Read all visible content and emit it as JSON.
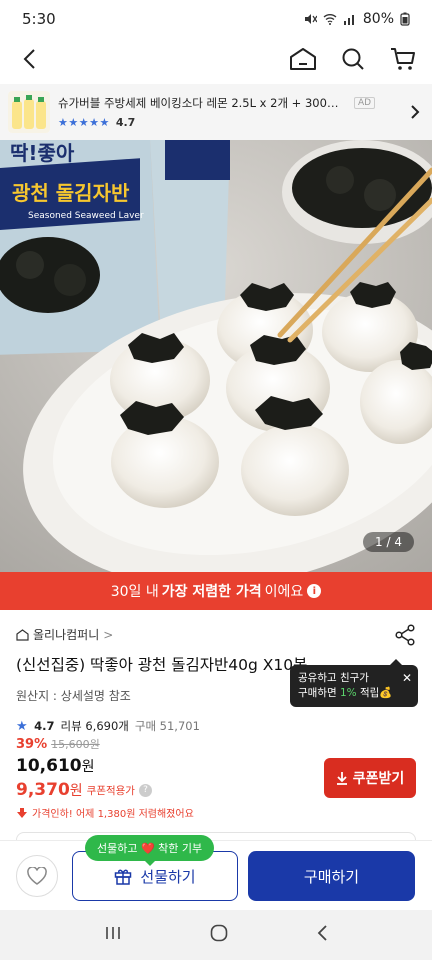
{
  "status_bar": {
    "time": "5:30",
    "battery": "80%"
  },
  "ad": {
    "title": "슈가버블 주방세제 베이킹소다 레몬 2.5L x 2개 + 300ml x 2개 ...",
    "tag": "AD",
    "stars": "★★★★★",
    "rating": "4.7"
  },
  "hero": {
    "pager": "1 / 4",
    "package_brand": "딱!좋아",
    "package_name": "광천 돌김자반",
    "package_sub": "Seasoned Seaweed Laver"
  },
  "price_banner": {
    "prefix": "30일 내",
    "highlight": "가장 저렴한 가격",
    "suffix": "이에요"
  },
  "product": {
    "seller": "올리나컴퍼니",
    "seller_arrow": ">",
    "title": "(신선집중) 딱좋아 광천 돌김자반40g X10봉",
    "origin": "원산지 : 상세설명 참조",
    "rating": "4.7",
    "review_count": "리뷰 6,690개",
    "sales": "구매 51,701"
  },
  "tooltip": {
    "line1": "공유하고 친구가",
    "line2_pre": "구매하면 ",
    "pct": "1%",
    "line2_post": " 적립💰"
  },
  "price": {
    "discount": "39%",
    "original": "15,600원",
    "sale_number": "10,610",
    "unit": "원",
    "coupon_number": "9,370",
    "coupon_label": "쿠폰적용가",
    "drop_note": "가격인하! 어제 1,380원 저렴해졌어요"
  },
  "buttons": {
    "coupon": "쿠폰받기",
    "gift": "선물하기",
    "buy": "구매하기",
    "gift_tag": "선물하고 ❤️ 착한 기부"
  },
  "colors": {
    "accent_red": "#e8402f",
    "brand_blue": "#1a39a8",
    "green": "#2fb84a"
  }
}
